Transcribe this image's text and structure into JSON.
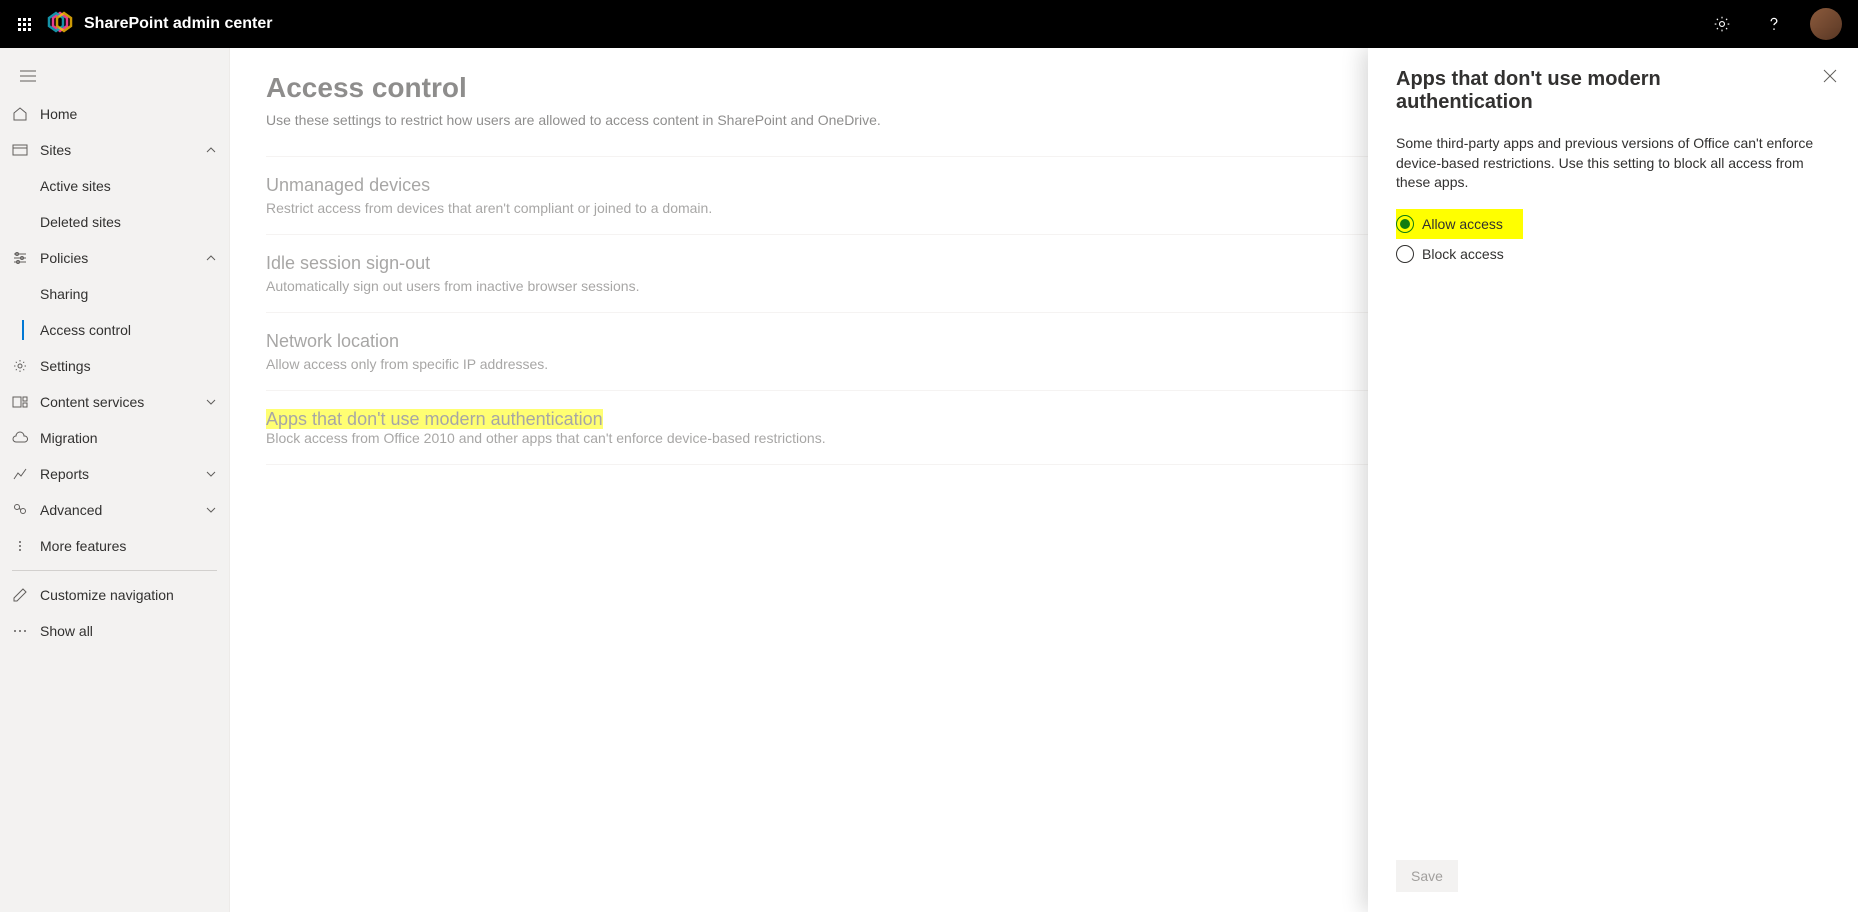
{
  "header": {
    "title": "SharePoint admin center"
  },
  "sidebar": {
    "home": "Home",
    "sites": "Sites",
    "active_sites": "Active sites",
    "deleted_sites": "Deleted sites",
    "policies": "Policies",
    "sharing": "Sharing",
    "access_control": "Access control",
    "settings": "Settings",
    "content_services": "Content services",
    "migration": "Migration",
    "reports": "Reports",
    "advanced": "Advanced",
    "more_features": "More features",
    "customize_navigation": "Customize navigation",
    "show_all": "Show all"
  },
  "page": {
    "title": "Access control",
    "subtitle": "Use these settings to restrict how users are allowed to access content in SharePoint and OneDrive.",
    "settings": [
      {
        "title": "Unmanaged devices",
        "desc": "Restrict access from devices that aren't compliant or joined to a domain."
      },
      {
        "title": "Idle session sign-out",
        "desc": "Automatically sign out users from inactive browser sessions."
      },
      {
        "title": "Network location",
        "desc": "Allow access only from specific IP addresses."
      },
      {
        "title": "Apps that don't use modern authentication",
        "desc": "Block access from Office 2010 and other apps that can't enforce device-based restrictions."
      }
    ]
  },
  "panel": {
    "title": "Apps that don't use modern authentication",
    "desc": "Some third-party apps and previous versions of Office can't enforce device-based restrictions. Use this setting to block all access from these apps.",
    "option_allow": "Allow access",
    "option_block": "Block access",
    "save": "Save"
  }
}
